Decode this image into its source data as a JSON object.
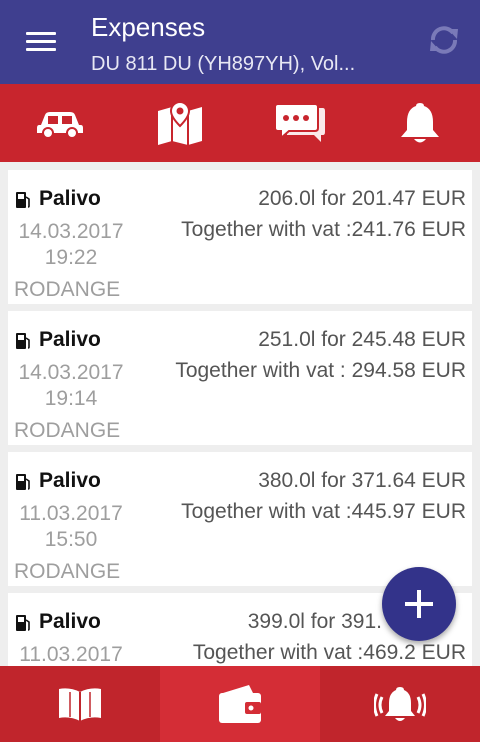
{
  "appbar": {
    "title": "Expenses",
    "subtitle": "DU 811 DU (YH897YH), Vol..."
  },
  "colors": {
    "appbar": "#3f3f8f",
    "accent_red": "#c8252d",
    "fab": "#33338a"
  },
  "tabs": [
    {
      "icon": "car-icon"
    },
    {
      "icon": "map-icon"
    },
    {
      "icon": "chat-icon"
    },
    {
      "icon": "bell-icon"
    }
  ],
  "expenses": [
    {
      "icon": "fuel-pump-icon",
      "type": "Palivo",
      "date": "14.03.2017",
      "time": "19:22",
      "place": "RODANGE",
      "amount": "206.0l for 201.47 EUR",
      "vat_label": "Together with vat :",
      "vat_value": "241.76 EUR"
    },
    {
      "icon": "fuel-pump-icon",
      "type": "Palivo",
      "date": "14.03.2017",
      "time": "19:14",
      "place": "RODANGE",
      "amount": "251.0l for 245.48 EUR",
      "vat_label": "Together with vat :",
      "vat_value": "294.58 EUR"
    },
    {
      "icon": "fuel-pump-icon",
      "type": "Palivo",
      "date": "11.03.2017",
      "time": "15:50",
      "place": "RODANGE",
      "amount": "380.0l for 371.64 EUR",
      "vat_label": "Together with vat :",
      "vat_value": "445.97 EUR"
    },
    {
      "icon": "fuel-pump-icon",
      "type": "Palivo",
      "date": "11.03.2017",
      "time": "",
      "place": "",
      "amount": "399.0l for 391.",
      "vat_label": "Together with vat :",
      "vat_value": "469.2 EUR"
    }
  ],
  "fab": {
    "icon": "plus-icon"
  },
  "bottom_nav": [
    {
      "icon": "book-icon",
      "active": false
    },
    {
      "icon": "wallet-icon",
      "active": true
    },
    {
      "icon": "alarm-bell-icon",
      "active": false
    }
  ]
}
